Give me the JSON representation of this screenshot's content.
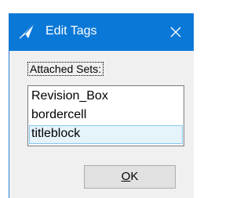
{
  "window": {
    "title": "Edit Tags",
    "accent_color": "#0a78d7",
    "icon": "app-icon",
    "close_icon": "close-icon"
  },
  "attached_sets": {
    "label": "Attached Sets:",
    "items": [
      {
        "label": "Revision_Box",
        "selected": false
      },
      {
        "label": "bordercell",
        "selected": false
      },
      {
        "label": "titleblock",
        "selected": true
      }
    ]
  },
  "buttons": {
    "ok_mnemonic": "O",
    "ok_rest": "K"
  }
}
